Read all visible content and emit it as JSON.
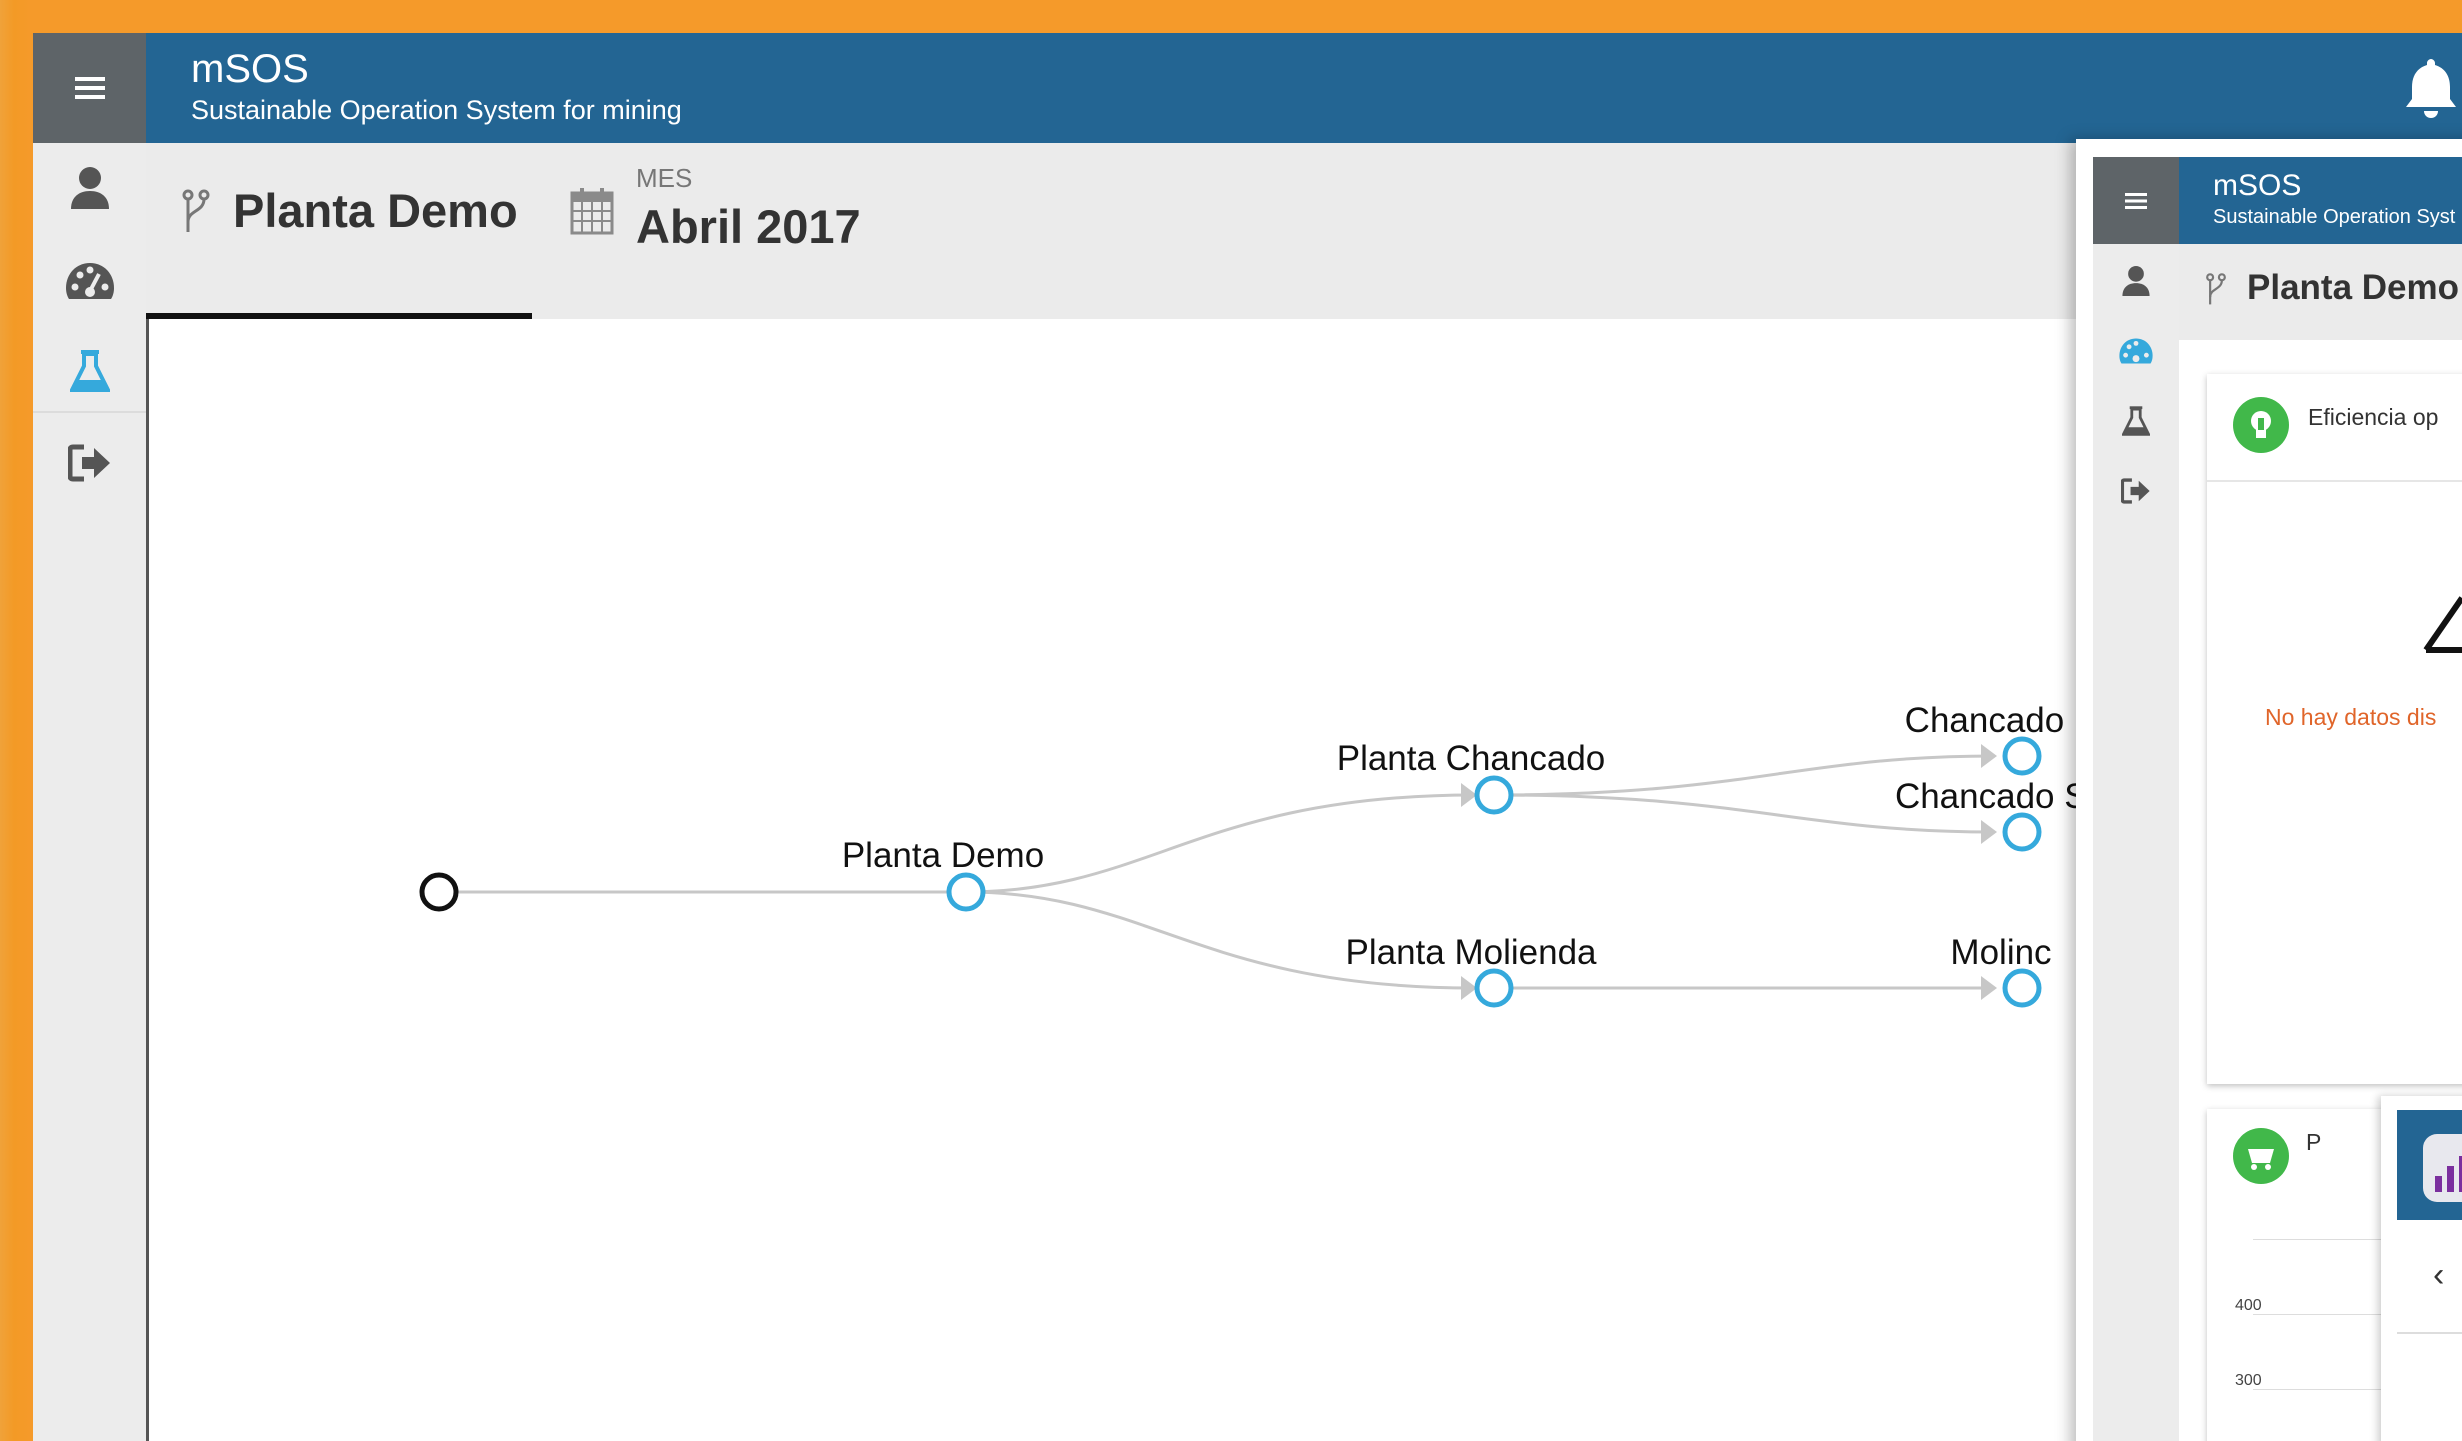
{
  "app": {
    "title": "mSOS",
    "subtitle": "Sustainable Operation System for mining"
  },
  "header": {
    "menu_icon": "hamburger-icon",
    "notification_icon": "bell-icon"
  },
  "sidebar": {
    "items": [
      {
        "icon": "user-icon",
        "active": false
      },
      {
        "icon": "dashboard-gauge-icon",
        "active": false
      },
      {
        "icon": "flask-icon",
        "active": true
      },
      {
        "icon": "logout-icon",
        "active": false
      }
    ]
  },
  "tabs": {
    "plant": {
      "icon": "branch-icon",
      "label": "Planta Demo"
    },
    "period": {
      "icon": "calendar-icon",
      "small_label": "MES",
      "label": "Abril 2017"
    }
  },
  "tree": {
    "root": {
      "label": ""
    },
    "nodes": [
      {
        "id": "planta-demo",
        "label": "Planta Demo"
      },
      {
        "id": "planta-chancado",
        "label": "Planta Chancado"
      },
      {
        "id": "planta-molienda",
        "label": "Planta Molienda"
      },
      {
        "id": "chancado-primario",
        "label": "Chancado P"
      },
      {
        "id": "chancado-secundario",
        "label": "Chancado Se"
      },
      {
        "id": "molino",
        "label": "Molinc"
      }
    ],
    "colors": {
      "node": "#35a9dc",
      "link": "#c7c7c7",
      "root": "#111111"
    }
  },
  "overlay": {
    "title": "mSOS",
    "subtitle": "Sustainable Operation Syst",
    "tab_label": "Planta Demo",
    "card1_title": "Eficiencia op",
    "no_data": "No hay datos dis",
    "card2_title": "P",
    "axis_400": "400",
    "axis_300": "300",
    "back_glyph": "‹"
  },
  "colors": {
    "frame": "#f59a2a",
    "header": "#236593",
    "accent": "#35a9dc",
    "warning_text": "#e0652a"
  }
}
